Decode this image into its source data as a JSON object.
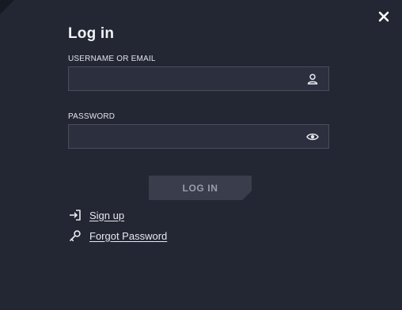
{
  "dialog": {
    "title": "Log in",
    "close_icon": "close-icon"
  },
  "username": {
    "label": "USERNAME OR EMAIL",
    "value": "",
    "icon": "user-icon"
  },
  "password": {
    "label": "PASSWORD",
    "value": "",
    "icon": "eye-icon"
  },
  "login_button": {
    "label": "LOG IN",
    "enabled": false
  },
  "links": {
    "signup": {
      "label": "Sign up",
      "icon": "sign-in-arrow-icon"
    },
    "forgot": {
      "label": "Forgot Password",
      "icon": "key-icon"
    }
  },
  "colors": {
    "background": "#232633",
    "field": "#2c2f3d",
    "field_border": "#4a4d5c",
    "button_disabled": "#3a3d4c",
    "button_text_disabled": "#9a9caa",
    "text": "#e8e9ee"
  }
}
